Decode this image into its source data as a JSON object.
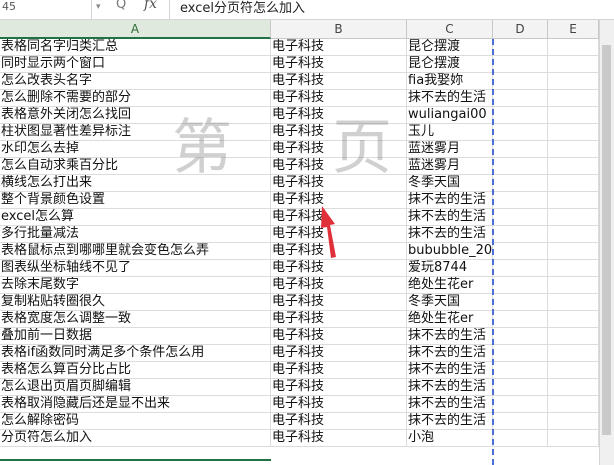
{
  "formula_bar": {
    "name_box": "45",
    "fx_symbol": "fx",
    "formula": "excel分页符怎么加入"
  },
  "columns": [
    "A",
    "B",
    "C",
    "D",
    "E"
  ],
  "rows": [
    {
      "a": "表格同名字归类汇总",
      "b": "电子科技",
      "c": "昆仑摆渡"
    },
    {
      "a": "同时显示两个窗口",
      "b": "电子科技",
      "c": "昆仑摆渡"
    },
    {
      "a": "怎么改表头名字",
      "b": "电子科技",
      "c": "fia我娶妳"
    },
    {
      "a": "怎么删除不需要的部分",
      "b": "电子科技",
      "c": "抹不去的生活"
    },
    {
      "a": "表格意外关闭怎么找回",
      "b": "电子科技",
      "c": "wuliangai00"
    },
    {
      "a": "柱状图显著性差异标注",
      "b": "电子科技",
      "c": "玉儿"
    },
    {
      "a": "水印怎么去掉",
      "b": "电子科技",
      "c": "蓝迷雾月"
    },
    {
      "a": "怎么自动求乘百分比",
      "b": "电子科技",
      "c": "蓝迷雾月"
    },
    {
      "a": "横线怎么打出来",
      "b": "电子科技",
      "c": "冬季天国"
    },
    {
      "a": "整个背景颜色设置",
      "b": "电子科技",
      "c": "抹不去的生活"
    },
    {
      "a": "excel怎么算",
      "b": "电子科技",
      "c": "抹不去的生活"
    },
    {
      "a": "多行批量减法",
      "b": "电子科技",
      "c": "抹不去的生活"
    },
    {
      "a": "表格鼠标点到哪哪里就会变色怎么弄",
      "b": "电子科技",
      "c": "bububble_20"
    },
    {
      "a": "图表纵坐标轴线不见了",
      "b": "电子科技",
      "c": "爱玩8744"
    },
    {
      "a": "去除末尾数字",
      "b": "电子科技",
      "c": "绝处生花er"
    },
    {
      "a": "复制粘贴转圈很久",
      "b": "电子科技",
      "c": "冬季天国"
    },
    {
      "a": "表格宽度怎么调整一致",
      "b": "电子科技",
      "c": "绝处生花er"
    },
    {
      "a": "叠加前一日数据",
      "b": "电子科技",
      "c": "抹不去的生活"
    },
    {
      "a": "表格if函数同时满足多个条件怎么用",
      "b": "电子科技",
      "c": "抹不去的生活"
    },
    {
      "a": "表格怎么算百分比占比",
      "b": "电子科技",
      "c": "抹不去的生活"
    },
    {
      "a": "怎么退出页眉页脚编辑",
      "b": "电子科技",
      "c": "抹不去的生活"
    },
    {
      "a": "表格取消隐藏后还是显不出来",
      "b": "电子科技",
      "c": "抹不去的生活"
    },
    {
      "a": "怎么解除密码",
      "b": "电子科技",
      "c": "抹不去的生活"
    },
    {
      "a": "分页符怎么加入",
      "b": "电子科技",
      "c": "小泡"
    }
  ],
  "watermark": {
    "left": "第",
    "right": "页"
  },
  "colors": {
    "accent_green": "#217346",
    "page_break_blue": "#4b6fd6",
    "arrow_red": "#e0303a"
  }
}
